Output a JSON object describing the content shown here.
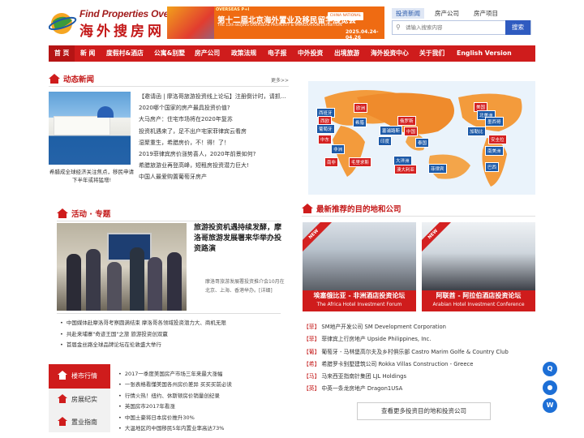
{
  "header": {
    "logo_en": "Find Properties Overseas",
    "logo_zh": "海外搜房网",
    "logo_badge": "CEN",
    "banner": {
      "brand": "OVERSEAS P+I",
      "title_zh": "第十二届北京海外置业及移民留学展览会",
      "title_en": "THE 12th BEIJING OVERSEAS PROPERTY & IMMIGRATION EXHIBITION",
      "dates": "2025.04.24-04.26",
      "corner": "CHINA NATIONAL"
    }
  },
  "search": {
    "tabs": [
      "投资新闻",
      "房产公司",
      "房产项目"
    ],
    "active_tab": 0,
    "placeholder": "请输入搜索内容",
    "button": "搜索"
  },
  "nav": {
    "items": [
      "首 页",
      "新 闻",
      "度假村&酒店",
      "公寓&别墅",
      "房产公司",
      "政策法规",
      "电子报",
      "中外投资",
      "出境旅游",
      "海外投资中心",
      "关于我们",
      "English Version"
    ]
  },
  "news": {
    "title": "动态新闻",
    "more": "更多>>",
    "image_caption": "希腊成全球经济关注焦点，移民申请下半年或将猛增!",
    "items": [
      "【邀请函 | 摩洛哥旅游投资线上论坛】注册倒计时，请抓...",
      "2020哪个国家的房产最具投资价值?",
      "大马房产：住宅市场将在2020年复苏",
      "投资机遇来了，足不出户宅家菲律宾云看房",
      "湿聚重生，希腊房价，不！得！了！",
      "2019菲律宾房价涨势喜人，2020年前景如何?",
      "希腊旅游业再登高峰，短租房投资潜力巨大!",
      "中国人最爱购置葡萄牙房产"
    ]
  },
  "map": {
    "labels_red": [
      "欧洲",
      "西欧",
      "俄罗斯",
      "中东",
      "中国",
      "美国",
      "北美洲",
      "加勒比",
      "安圭拉"
    ],
    "labels_blue": [
      "西班牙",
      "葡萄牙",
      "非洲",
      "南非",
      "塞浦路斯",
      "毛里求斯",
      "泰国",
      "澳大利亚",
      "大洋洲",
      "菲律宾",
      "南美洲",
      "希腊",
      "墨西哥",
      "巴西",
      "印度"
    ]
  },
  "activity": {
    "title": "活动 · 专题",
    "headline": "旅游投资机遇持续发酵，摩洛哥旅游发展署来华举办投资路演",
    "summary": "摩洛哥旅游发展署投资推介会10月在北京、上海、香港举办。[详细]",
    "items": [
      "中国媒体赴摩洛哥考察圆满结束 摩洛哥各领域投资潜力大、商机无限",
      "共赴来埔寨\"奇迹王国\"之旅 旅游投资创双赢",
      "首届金丝路全球品牌论坛在伦敦盛大举行"
    ]
  },
  "left_tabs": {
    "tabs": [
      "楼市行情",
      "房展纪实",
      "置业指南"
    ],
    "active": 0,
    "items": [
      "2017一季度美国房产市场三年来最大涨幅",
      "一张表格看懂美国各州房价差异 买买买前必读",
      "行情火热！纽约、休斯顿房价销量创纪录",
      "英国房市2017年看涨",
      "中国土豪将日本房价推升30%",
      "大温地区的中国移民5年内置业率高达73%"
    ]
  },
  "destinations": {
    "title": "最新推荐的目的地和公司",
    "ribbon": "NEW",
    "cards": [
      {
        "name": "埃塞俄比亚 - 非洲酒店投资论坛",
        "sub": "The Africa Hotel Investment Forum"
      },
      {
        "name": "阿联酋 - 阿拉伯酒店投资论坛",
        "sub": "Arabian Hotel Investment Conference"
      }
    ],
    "companies": [
      {
        "tag": "【菲】",
        "name": "SM地产开发公司 SM Development Corporation"
      },
      {
        "tag": "【菲】",
        "name": "菲律宾上行房地产 Upside Philippines, Inc."
      },
      {
        "tag": "【葡】",
        "name": "葡萄牙 - 马林堡高尔夫及乡村俱乐部 Castro Marim Golfe & Country Club"
      },
      {
        "tag": "【希】",
        "name": "希腊罗卡别墅建筑公司 Rokka Villas Construction - Greece"
      },
      {
        "tag": "【马】",
        "name": "马来西亚指南针集团 LJL Holdings"
      },
      {
        "tag": "【英】",
        "name": "中英一条龙房地产 Dragon1USA"
      }
    ],
    "more_button": "查看更多投资目的地和投资公司"
  },
  "float_icons": [
    "qq-icon",
    "wechat-icon",
    "weibo-icon"
  ]
}
